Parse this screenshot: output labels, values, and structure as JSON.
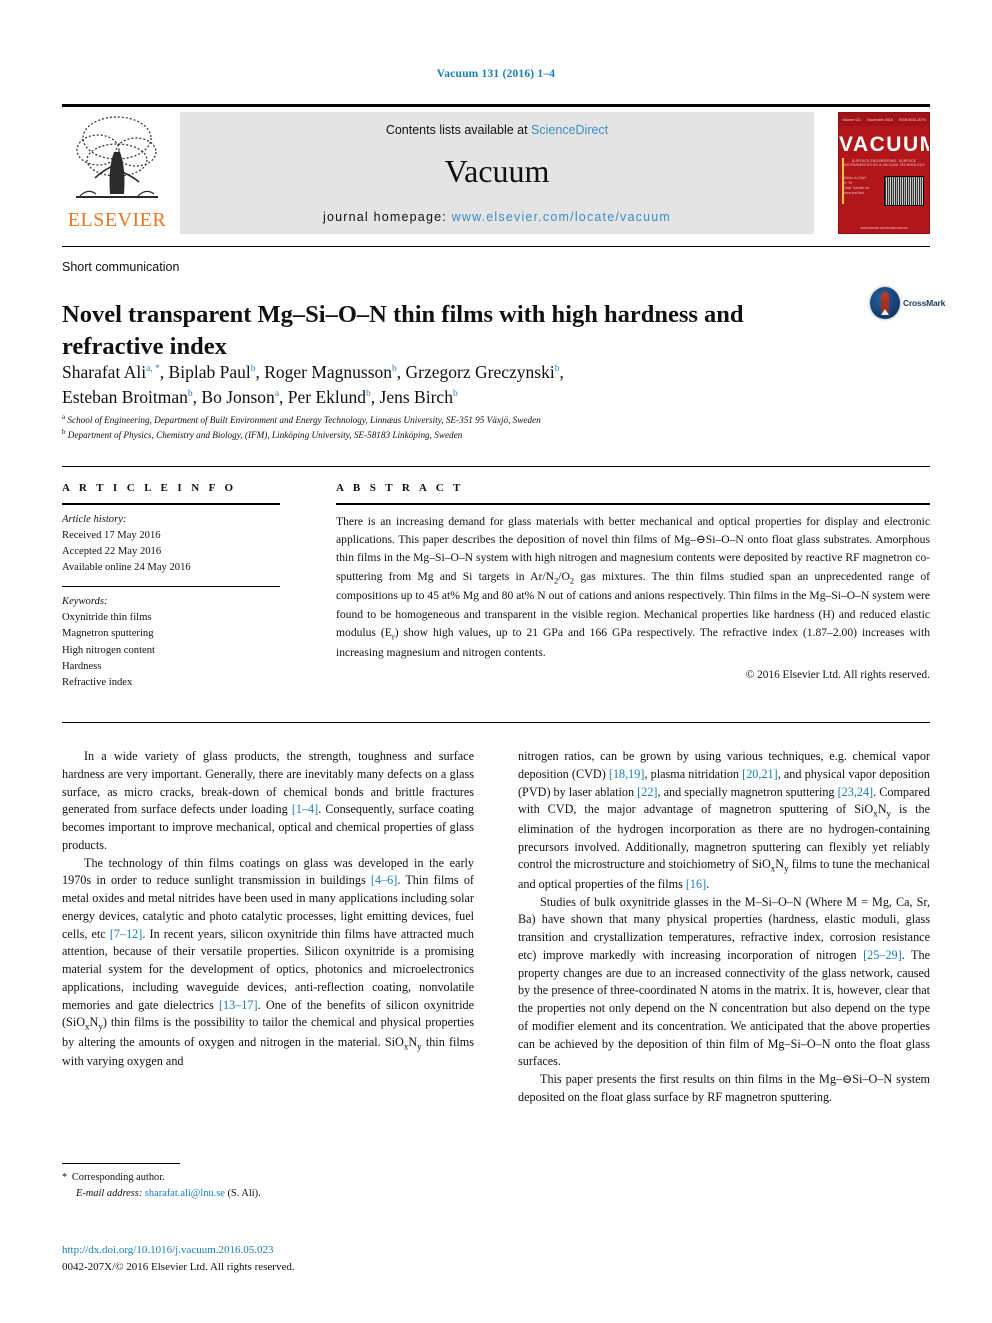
{
  "running_head": "Vacuum 131 (2016) 1–4",
  "masthead": {
    "publisher": "ELSEVIER",
    "contents_prefix": "Contents lists available at ",
    "contents_link": "ScienceDirect",
    "journal_name": "Vacuum",
    "homepage_prefix": "journal homepage: ",
    "homepage_url": "www.elsevier.com/locate/vacuum",
    "cover": {
      "title": "VACUUM",
      "subtitle": "SURFACE ENGINEERING, SURFACE INSTRUMENTATION & VACUUM TECHNOLOGY",
      "top_items": [
        "Volume 131",
        "November 2016",
        "ISSN 0042-207X"
      ],
      "left_lines": [
        "Editor-in-Chief",
        "H. Ye",
        "Total Transfer for",
        "area and fast",
        "In this Issue",
        "Co-Based",
        "and Rigar",
        "Deposition",
        "for Single",
        "crystallisation"
      ],
      "footer": "www.elsevier.com/locate/vacuum"
    }
  },
  "article": {
    "kind": "Short communication",
    "title": "Novel transparent Mg–Si–O–N thin films with high hardness and refractive index",
    "crossmark_label": "CrossMark",
    "authors_line1": "Sharafat Ali",
    "authors": [
      {
        "name": "Sharafat Ali",
        "sup": "a, *"
      },
      {
        "name": "Biplab Paul",
        "sup": "b"
      },
      {
        "name": "Roger Magnusson",
        "sup": "b"
      },
      {
        "name": "Grzegorz Greczynski",
        "sup": "b"
      },
      {
        "name": "Esteban Broitman",
        "sup": "b"
      },
      {
        "name": "Bo Jonson",
        "sup": "a"
      },
      {
        "name": "Per Eklund",
        "sup": "b"
      },
      {
        "name": "Jens Birch",
        "sup": "b"
      }
    ],
    "affiliations": [
      {
        "sup": "a",
        "text": "School of Engineering, Department of Built Environment and Energy Technology, Linnæus University, SE-351 95 Växjö, Sweden"
      },
      {
        "sup": "b",
        "text": "Department of Physics, Chemistry and Biology, (IFM), Linköping University, SE-58183 Linköping, Sweden"
      }
    ]
  },
  "article_info": {
    "heading": "A R T I C L E  I N F O",
    "history_label": "Article history:",
    "history": [
      "Received 17 May 2016",
      "Accepted 22 May 2016",
      "Available online 24 May 2016"
    ],
    "keywords_label": "Keywords:",
    "keywords": [
      "Oxynitride thin films",
      "Magnetron sputtering",
      "High nitrogen content",
      "Hardness",
      "Refractive index"
    ]
  },
  "abstract": {
    "heading": "A B S T R A C T",
    "text": "There is an increasing demand for glass materials with better mechanical and optical properties for display and electronic applications. This paper describes the deposition of novel thin films of Mg–⊖Si–O–N onto float glass substrates. Amorphous thin films in the Mg–Si–O–N system with high nitrogen and magnesium contents were deposited by reactive RF magnetron co-sputtering from Mg and Si targets in Ar/N2/O2 gas mixtures. The thin films studied span an unprecedented range of compositions up to 45 at% Mg and 80 at% N out of cations and anions respectively. Thin films in the Mg–Si–O–N system were found to be homogeneous and transparent in the visible region. Mechanical properties like hardness (H) and reduced elastic modulus (Er) show high values, up to 21 GPa and 166 GPa respectively. The refractive index (1.87–2.00) increases with increasing magnesium and nitrogen contents.",
    "copyright": "© 2016 Elsevier Ltd. All rights reserved."
  },
  "body": {
    "left_paragraphs": [
      "In a wide variety of glass products, the strength, toughness and surface hardness are very important. Generally, there are inevitably many defects on a glass surface, as micro cracks, break-down of chemical bonds and brittle fractures generated from surface defects under loading [1–4]. Consequently, surface coating becomes important to improve mechanical, optical and chemical properties of glass products.",
      "The technology of thin films coatings on glass was developed in the early 1970s in order to reduce sunlight transmission in buildings [4–6]. Thin films of metal oxides and metal nitrides have been used in many applications including solar energy devices, catalytic and photo catalytic processes, light emitting devices, fuel cells, etc [7–12]. In recent years, silicon oxynitride thin films have attracted much attention, because of their versatile properties. Silicon oxynitride is a promising material system for the development of optics, photonics and microelectronics applications, including waveguide devices, anti-reflection coating, nonvolatile memories and gate dielectrics [13–17]. One of the benefits of silicon oxynitride (SiOxNy) thin films is the possibility to tailor the chemical and physical properties by altering the amounts of oxygen and nitrogen in the material. SiOxNy thin films with varying oxygen and"
    ],
    "right_paragraphs": [
      "nitrogen ratios, can be grown by using various techniques, e.g. chemical vapor deposition (CVD) [18,19], plasma nitridation [20,21], and physical vapor deposition (PVD) by laser ablation [22], and specially magnetron sputtering [23,24]. Compared with CVD, the major advantage of magnetron sputtering of SiOxNy is the elimination of the hydrogen incorporation as there are no hydrogen-containing precursors involved. Additionally, magnetron sputtering can flexibly yet reliably control the microstructure and stoichiometry of SiOxNy films to tune the mechanical and optical properties of the films [16].",
      "Studies of bulk oxynitride glasses in the M–Si–O–N (Where M = Mg, Ca, Sr, Ba) have shown that many physical properties (hardness, elastic moduli, glass transition and crystallization temperatures, refractive index, corrosion resistance etc) improve markedly with increasing incorporation of nitrogen [25–29]. The property changes are due to an increased connectivity of the glass network, caused by the presence of three-coordinated N atoms in the matrix. It is, however, clear that the properties not only depend on the N concentration but also depend on the type of modifier element and its concentration. We anticipated that the above properties can be achieved by the deposition of thin film of Mg–Si–O–N onto the float glass surfaces.",
      "This paper presents the first results on thin films in the Mg–⊖Si–O–N system deposited on the float glass surface by RF magnetron sputtering."
    ]
  },
  "footnotes": {
    "corresponding_marker": "*",
    "corresponding": "Corresponding author.",
    "email_label": "E-mail address:",
    "email": "sharafat.ali@lnu.se",
    "email_owner": "(S. Ali)."
  },
  "doi": {
    "url": "http://dx.doi.org/10.1016/j.vacuum.2016.05.023",
    "issn_line": "0042-207X/© 2016 Elsevier Ltd. All rights reserved."
  },
  "colors": {
    "link": "#1a7db6",
    "elsevier_orange": "#E87722",
    "cover_red": "#b1161b"
  }
}
